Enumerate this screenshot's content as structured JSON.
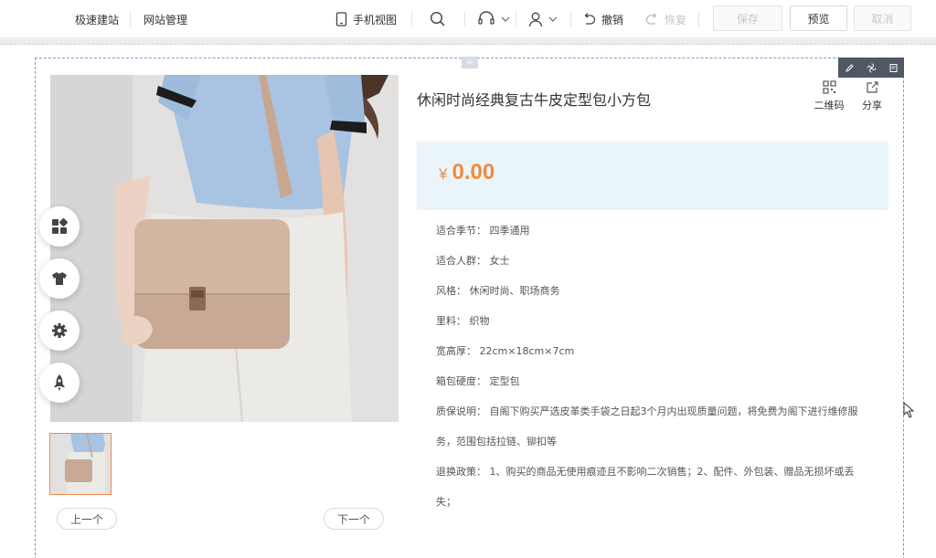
{
  "toolbar": {
    "nav": [
      "极速建站",
      "网站管理"
    ],
    "mobile_view": "手机视图",
    "undo": "撤销",
    "redo": "恢复",
    "save": "保存",
    "preview": "预览",
    "cancel": "取消"
  },
  "product": {
    "title": "休闲时尚经典复古牛皮定型包小方包",
    "currency": "¥",
    "price": "0.00",
    "qrcode_label": "二维码",
    "share_label": "分享",
    "prev_label": "上一个",
    "next_label": "下一个",
    "attributes": [
      {
        "label": "适合季节：",
        "value": "四季通用"
      },
      {
        "label": "适合人群：",
        "value": "女士"
      },
      {
        "label": "风格：",
        "value": "休闲时尚、职场商务"
      },
      {
        "label": "里料：",
        "value": "织物"
      },
      {
        "label": "宽高厚：",
        "value": "22cm×18cm×7cm"
      },
      {
        "label": "箱包硬度：",
        "value": "定型包"
      }
    ],
    "warranty_label": "质保说明：",
    "warranty_line1": "自阁下购买严选皮革类手袋之日起3个月内出现质量问题，将免费为阁下进行维修服",
    "warranty_line2": "务，范围包括拉链、铆扣等",
    "return_label": "退换政策：",
    "return_line1": "1、购买的商品无使用痕迹且不影响二次销售；2、配件、外包装、赠品无损坏或丢",
    "return_line2": "失；"
  },
  "side_tools": [
    "modules-icon",
    "theme-shirt-icon",
    "settings-gear-icon",
    "rocket-icon"
  ],
  "colors": {
    "accent_price": "#ef8b3c",
    "price_bg": "#e9f5fa",
    "thumb_border": "#f08a4b"
  }
}
